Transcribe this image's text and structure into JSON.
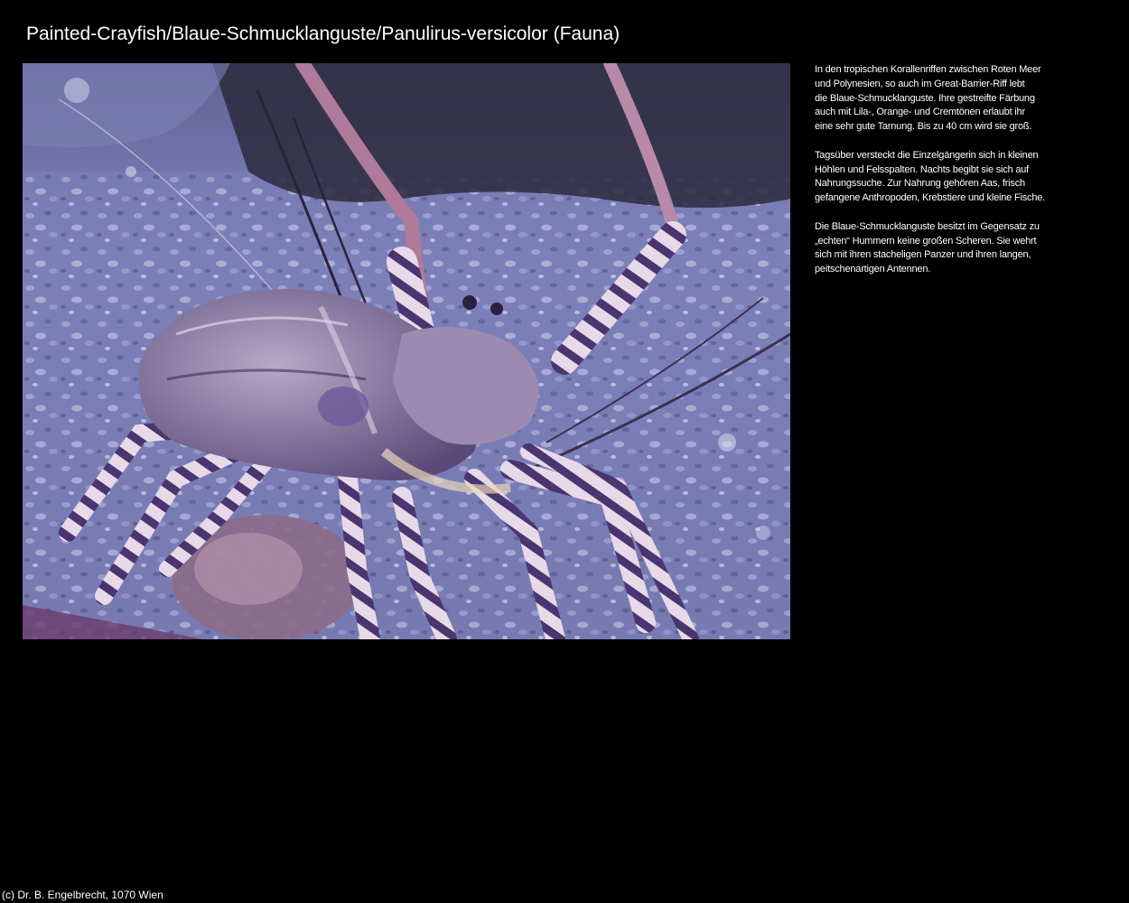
{
  "page": {
    "title": "Painted-Crayfish/Blaue-Schmucklanguste/Panulirus-versicolor (Fauna)"
  },
  "description": {
    "paragraphs": [
      {
        "lines": [
          "In den tropischen Korallenriffen zwischen Roten Meer",
          "und Polynesien, so auch im Great-Barrier-Riff lebt",
          "die Blaue-Schmucklanguste. Ihre gestreifte Färbung",
          "auch mit Lila-, Orange- und Cremtönen erlaubt ihr",
          "eine sehr gute Tarnung. Bis zu 40 cm wird sie groß."
        ]
      },
      {
        "lines": [
          "Tagsüber versteckt die Einzelgängerin sich in kleinen",
          "Höhlen und Felsspalten. Nachts begibt sie sich auf",
          "Nahrungssuche. Zur Nahrung gehören Aas, frisch",
          "gefangene Anthropoden, Krebstiere und kleine Fische."
        ]
      },
      {
        "lines": [
          "Die Blaue-Schmucklanguste besitzt im Gegensatz zu",
          "„echten“ Hummern keine großen Scheren. Sie wehrt",
          "sich mit ihren stacheligen Panzer und ihren langen,",
          "peitschenartigen Antennen."
        ]
      }
    ]
  },
  "footer": {
    "copyright": "(c) Dr. B. Engelbrecht, 1070 Wien"
  },
  "colors": {
    "background": "#000000",
    "text": "#ffffff",
    "gravel": "#7c80b8",
    "lobster_stripe": "#4a3570",
    "lobster_cream": "#e8d9e8"
  }
}
